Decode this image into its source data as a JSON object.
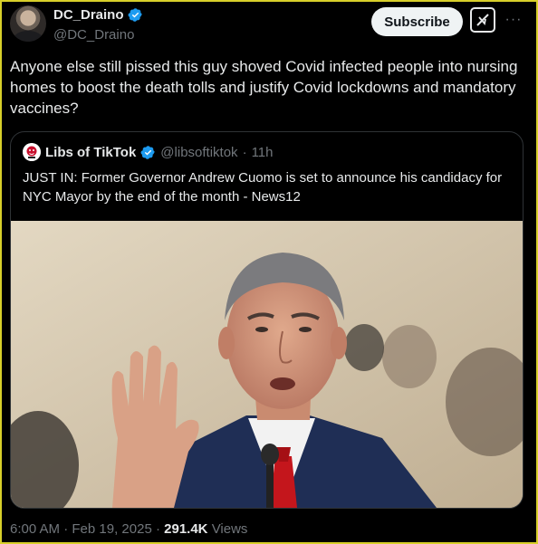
{
  "author": {
    "display_name": "DC_Draino",
    "handle": "@DC_Draino",
    "verified": true
  },
  "actions": {
    "subscribe_label": "Subscribe"
  },
  "tweet_text": "Anyone else still pissed this guy shoved Covid infected people into nursing homes to boost the death tolls and justify Covid lockdowns and mandatory vaccines?",
  "quoted": {
    "display_name": "Libs of TikTok",
    "handle": "@libsoftiktok",
    "separator": "·",
    "time": "11h",
    "text": "JUST IN: Former Governor Andrew Cuomo is set to announce his candidacy for NYC Mayor by the end of the month - News12"
  },
  "meta": {
    "time": "6:00 AM",
    "sep1": "·",
    "date": "Feb 19, 2025",
    "sep2": "·",
    "views_count": "291.4K",
    "views_label": "Views"
  },
  "colors": {
    "background": "#000000",
    "text": "#e7e9ea",
    "muted": "#71767b",
    "verified_blue": "#1d9bf0",
    "border": "#2f3336"
  }
}
